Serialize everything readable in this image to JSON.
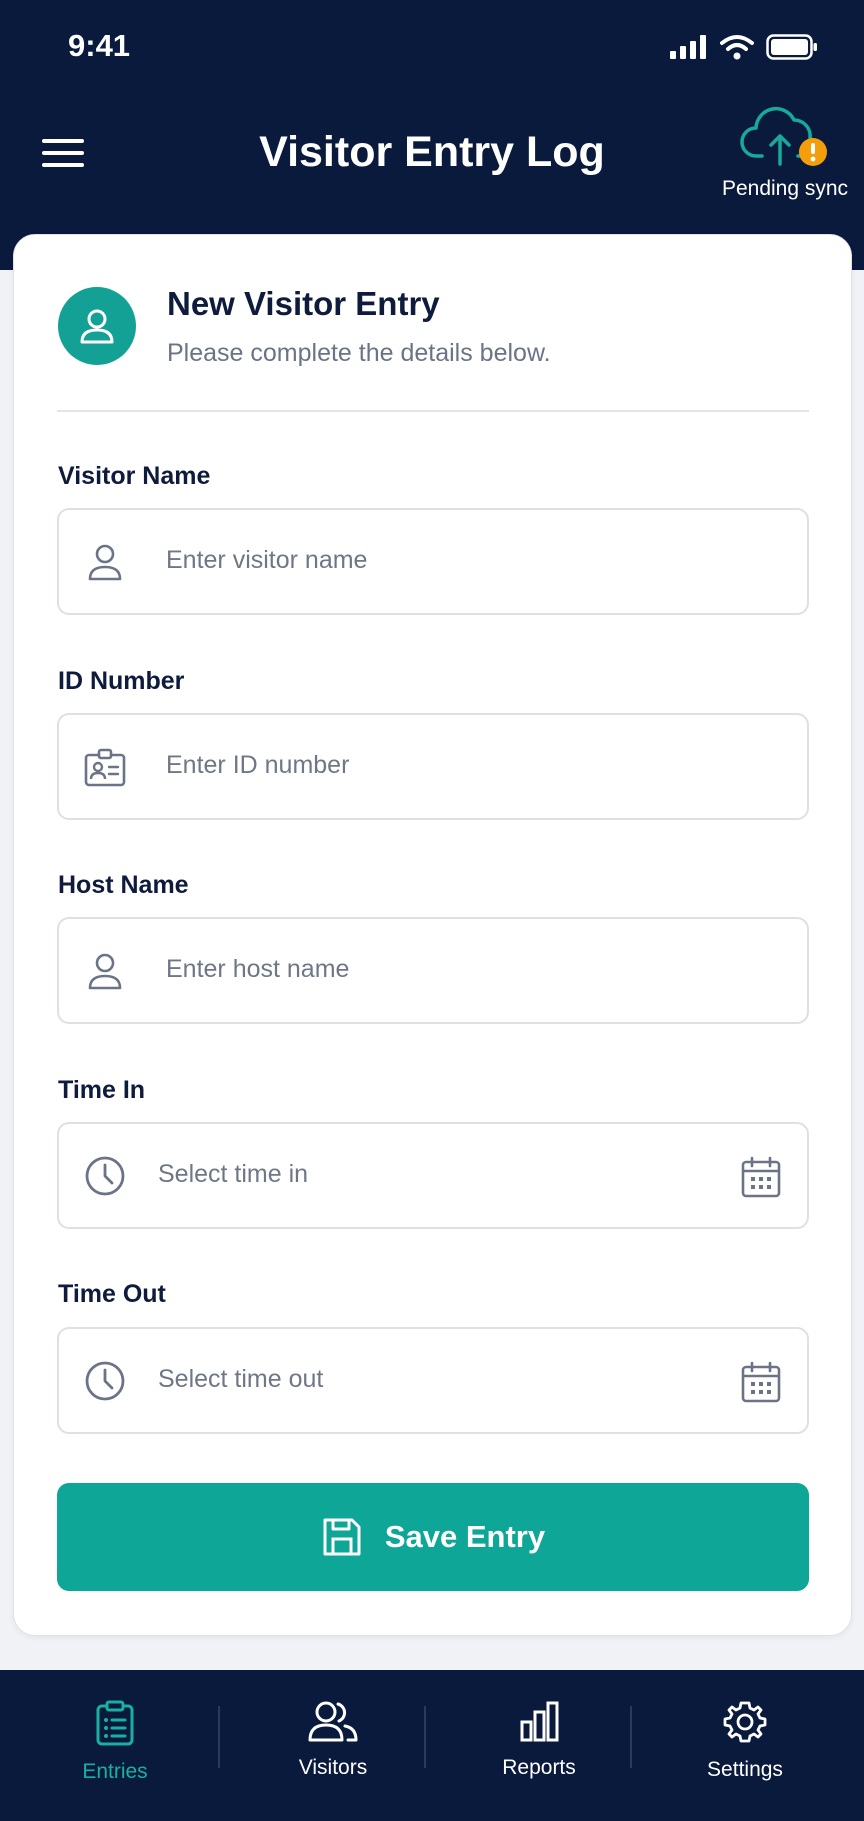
{
  "status_bar": {
    "time": "9:41"
  },
  "header": {
    "title": "Visitor Entry Log",
    "sync_label": "Pending sync"
  },
  "form": {
    "title": "New Visitor Entry",
    "subtitle": "Please complete the details below.",
    "fields": [
      {
        "label": "Visitor Name",
        "placeholder": "Enter visitor name",
        "icon": "user-icon"
      },
      {
        "label": "ID Number",
        "placeholder": "Enter ID number",
        "icon": "id-card-icon"
      },
      {
        "label": "Host Name",
        "placeholder": "Enter host name",
        "icon": "user-icon"
      },
      {
        "label": "Time In",
        "placeholder": "Select time in",
        "icon": "clock-icon"
      },
      {
        "label": "Time Out",
        "placeholder": "Select time out",
        "icon": "clock-icon"
      }
    ],
    "save_label": "Save Entry"
  },
  "nav": {
    "items": [
      {
        "label": "Entries",
        "icon": "clipboard-list-icon",
        "active": true
      },
      {
        "label": "Visitors",
        "icon": "users-icon",
        "active": false
      },
      {
        "label": "Reports",
        "icon": "bar-chart-icon",
        "active": false
      },
      {
        "label": "Settings",
        "icon": "gear-icon",
        "active": false
      }
    ]
  },
  "colors": {
    "header_bg": "#0a1a3c",
    "accent": "#0ea696",
    "warning": "#f59e0b"
  }
}
